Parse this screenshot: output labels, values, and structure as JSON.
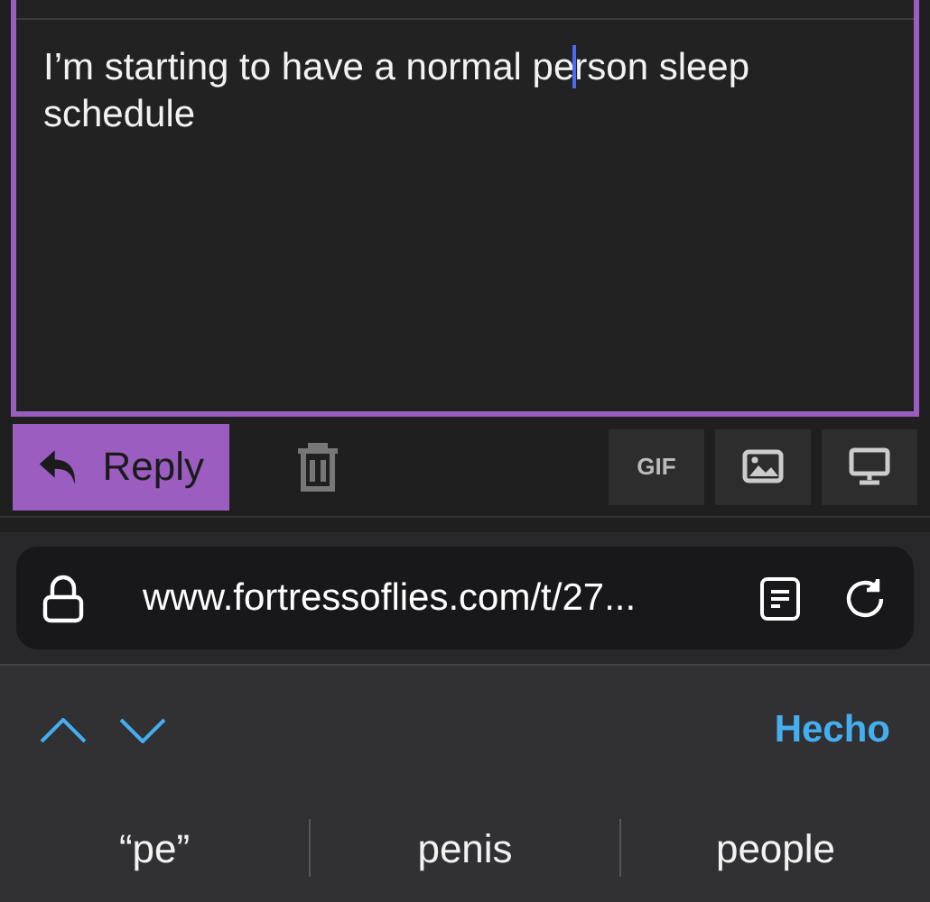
{
  "editor": {
    "text_before_cursor": "I’m starting to have a normal pe",
    "text_after_cursor": "rson sleep schedule",
    "focused": true
  },
  "composer_actions": {
    "reply_button": "Reply",
    "toolbar_buttons": [
      {
        "kind": "text",
        "label": "GIF"
      },
      {
        "kind": "image"
      },
      {
        "kind": "monitor"
      }
    ]
  },
  "address_bar": {
    "url": "www.fortressoflies.com/t/27..."
  },
  "keyboard_toolbar": {
    "done": "Hecho"
  },
  "suggestions": [
    "“pe”",
    "penis",
    "people"
  ]
}
